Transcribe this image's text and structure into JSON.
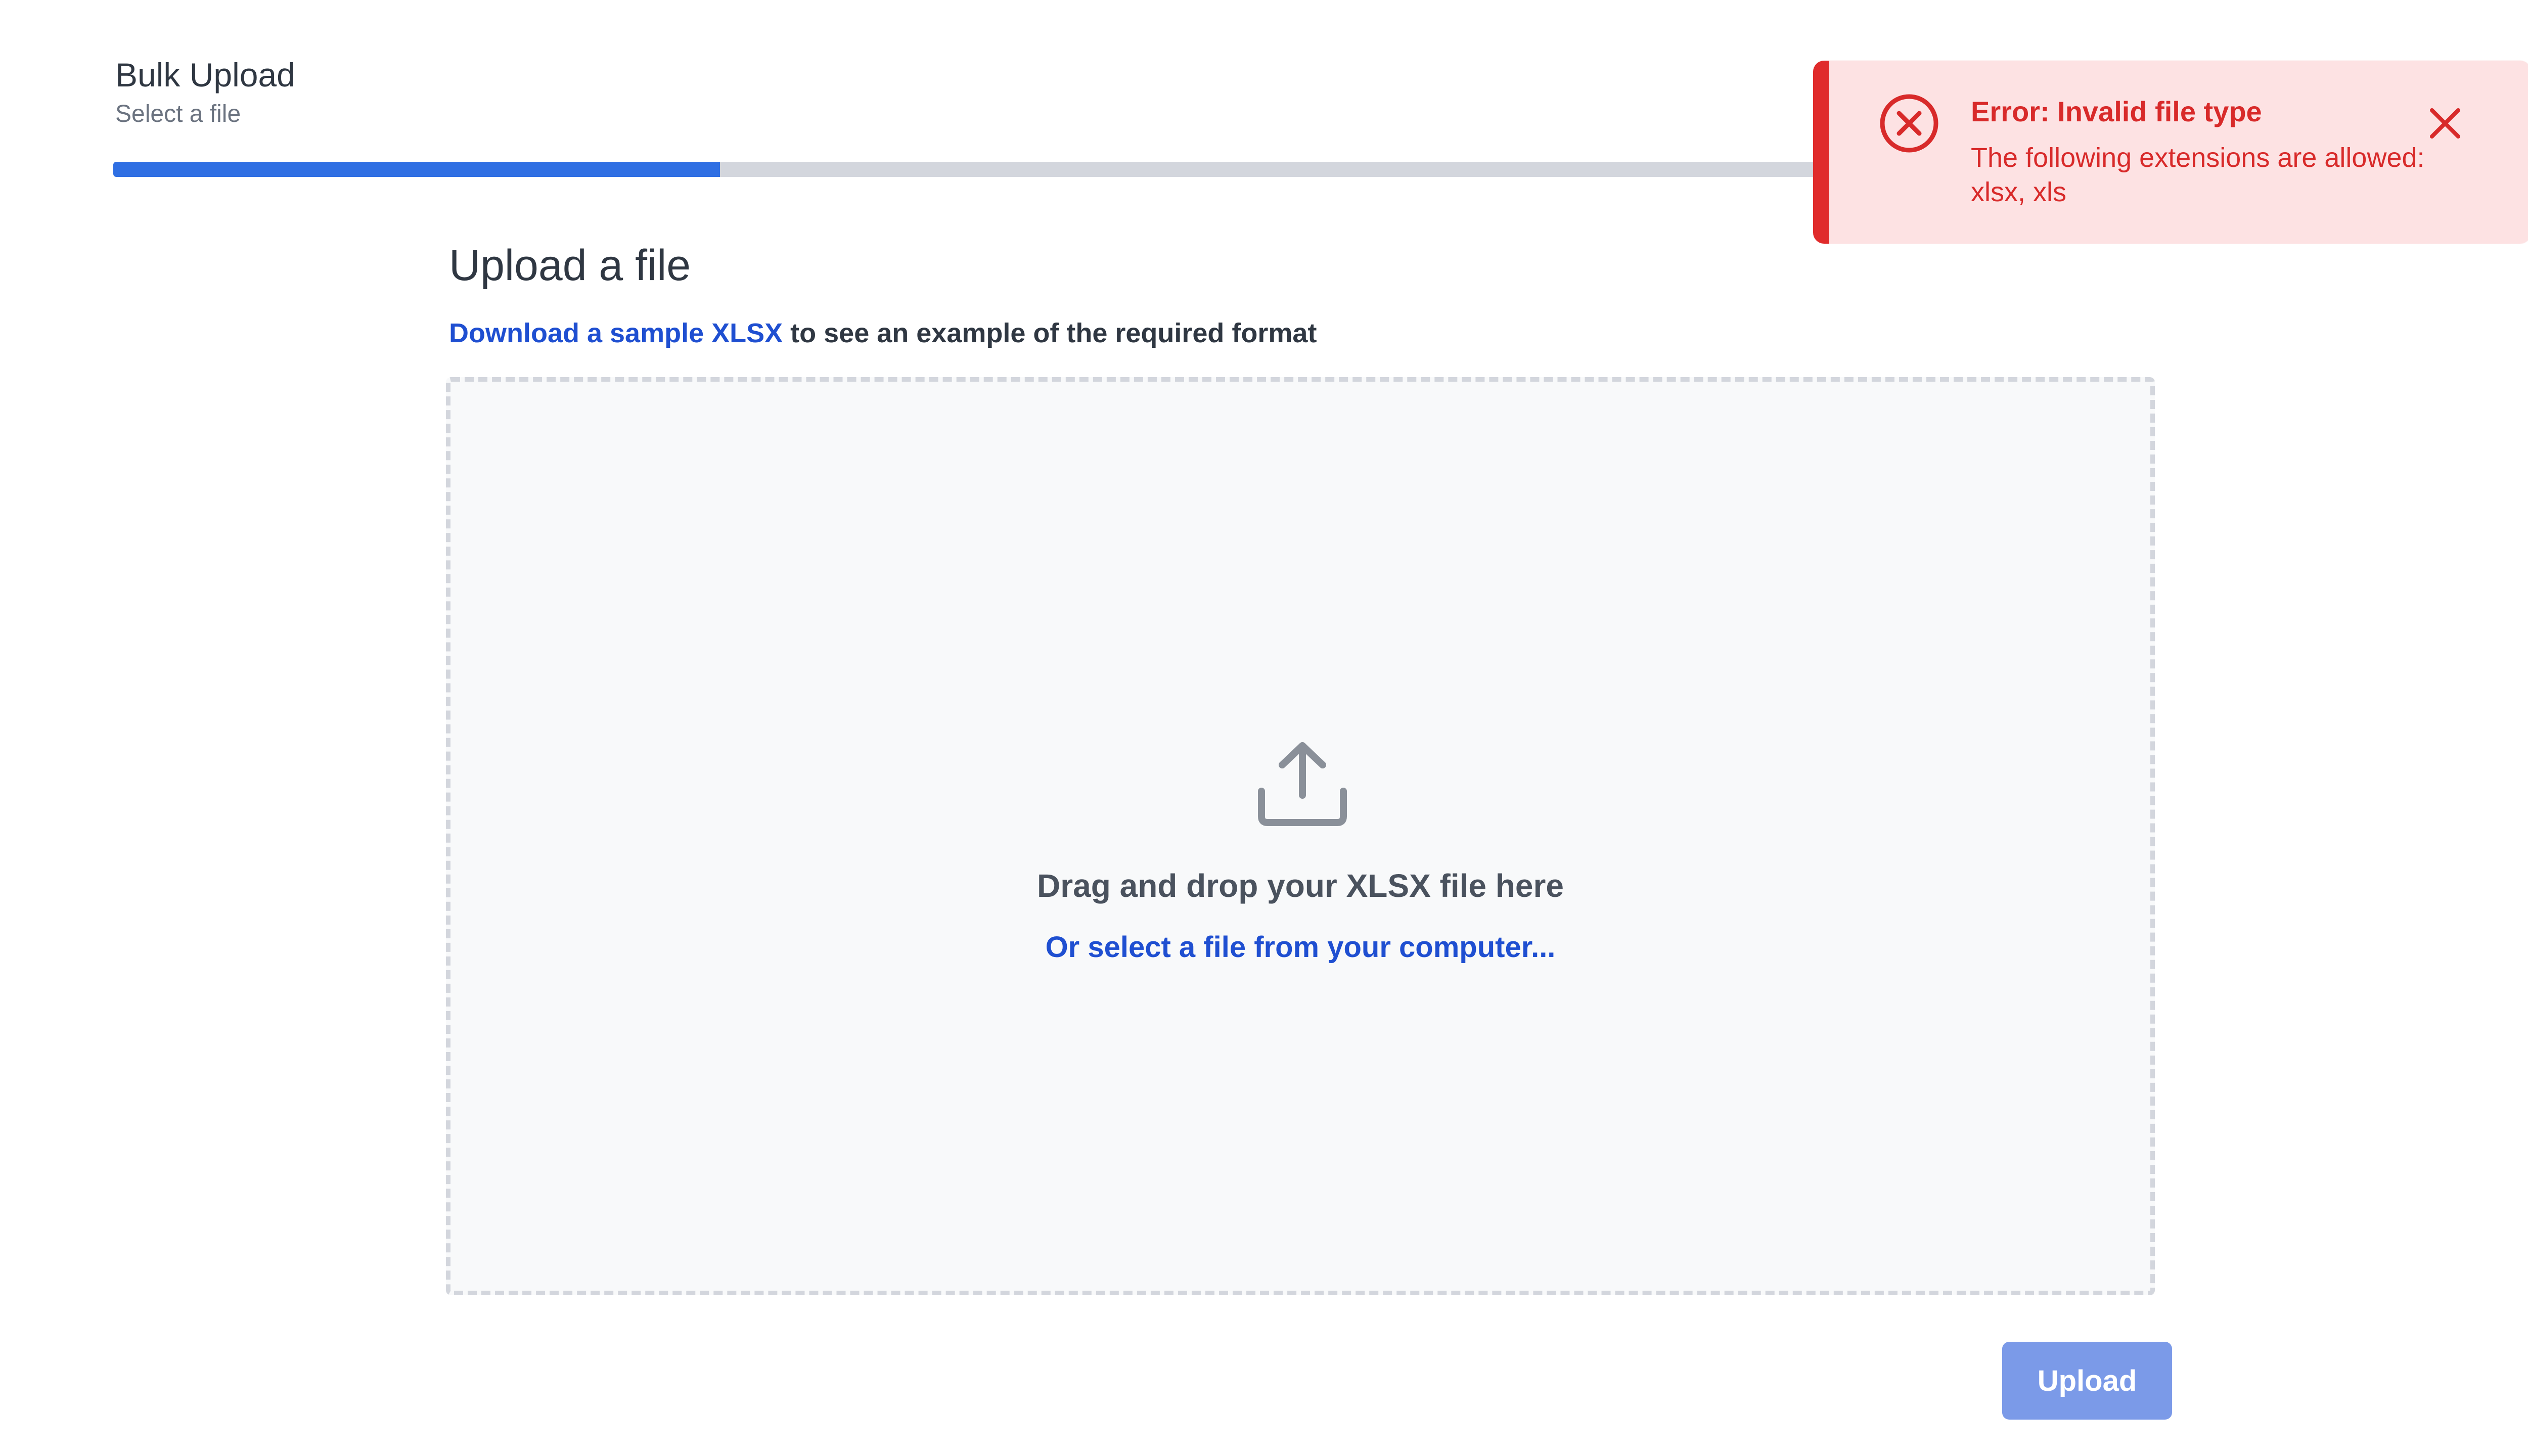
{
  "header": {
    "title": "Bulk Upload",
    "subtitle": "Select a file"
  },
  "progress": {
    "fraction": 0.25,
    "accent_color": "#2f6fe3",
    "track_color": "#d3d6dd"
  },
  "main": {
    "title": "Upload a file",
    "sample_link": "Download a sample XLSX",
    "sample_suffix": " to see an example of the required format"
  },
  "dropzone": {
    "icon": "upload-icon",
    "title": "Drag and drop your XLSX file here",
    "select_link": "Or select a file from your computer..."
  },
  "actions": {
    "upload_label": "Upload"
  },
  "toast": {
    "type": "error",
    "icon": "error-circle-x-icon",
    "title": "Error: Invalid file type",
    "message": "The following extensions are allowed: xlsx, xls",
    "close_icon": "close-icon",
    "color": "#d82a2a",
    "background": "#fde2e3"
  }
}
